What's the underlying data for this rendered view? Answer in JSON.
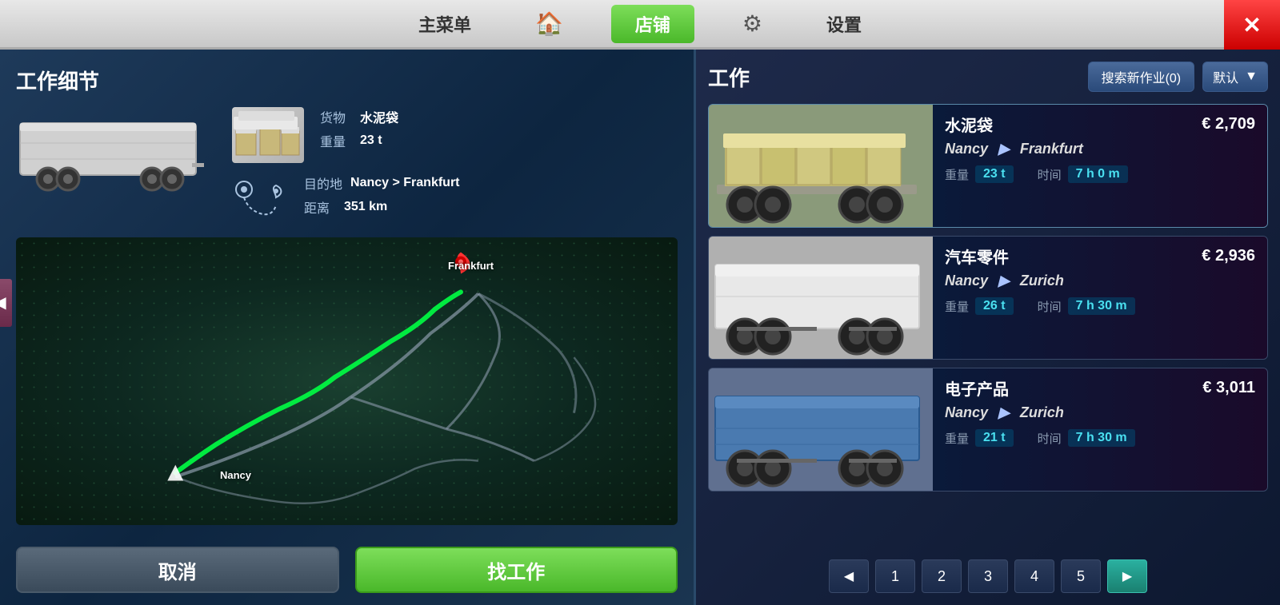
{
  "nav": {
    "main_menu": "主菜单",
    "home_icon": "🏠",
    "shop": "店铺",
    "settings_icon": "⚙",
    "settings": "设置",
    "close": "✕"
  },
  "left_panel": {
    "title": "工作细节",
    "cargo_label": "货物",
    "cargo_value": "水泥袋",
    "weight_label": "重量",
    "weight_value": "23 t",
    "destination_label": "目的地",
    "destination_value": "Nancy > Frankfurt",
    "distance_label": "距离",
    "distance_value": "351 km",
    "frankfurt_label": "Frankfurt",
    "nancy_label": "Nancy",
    "cancel_btn": "取消",
    "find_btn": "找工作"
  },
  "right_panel": {
    "title": "工作",
    "search_btn": "搜索新作业(0)",
    "default_label": "默认",
    "jobs": [
      {
        "id": 1,
        "name": "水泥袋",
        "price": "€ 2,709",
        "from": "Nancy",
        "to": "Frankfurt",
        "weight_label": "重量",
        "weight_value": "23 t",
        "time_label": "时间",
        "time_value": "7 h 0 m",
        "type": "flatbed"
      },
      {
        "id": 2,
        "name": "汽车零件",
        "price": "€ 2,936",
        "from": "Nancy",
        "to": "Zurich",
        "weight_label": "重量",
        "weight_value": "26 t",
        "time_label": "时间",
        "time_value": "7 h 30 m",
        "type": "white"
      },
      {
        "id": 3,
        "name": "电子产品",
        "price": "€ 3,011",
        "from": "Nancy",
        "to": "Zurich",
        "weight_label": "重量",
        "weight_value": "21 t",
        "time_label": "时间",
        "time_value": "7 h 30 m",
        "type": "blue"
      }
    ],
    "pages": [
      "1",
      "2",
      "3",
      "4",
      "5"
    ]
  }
}
